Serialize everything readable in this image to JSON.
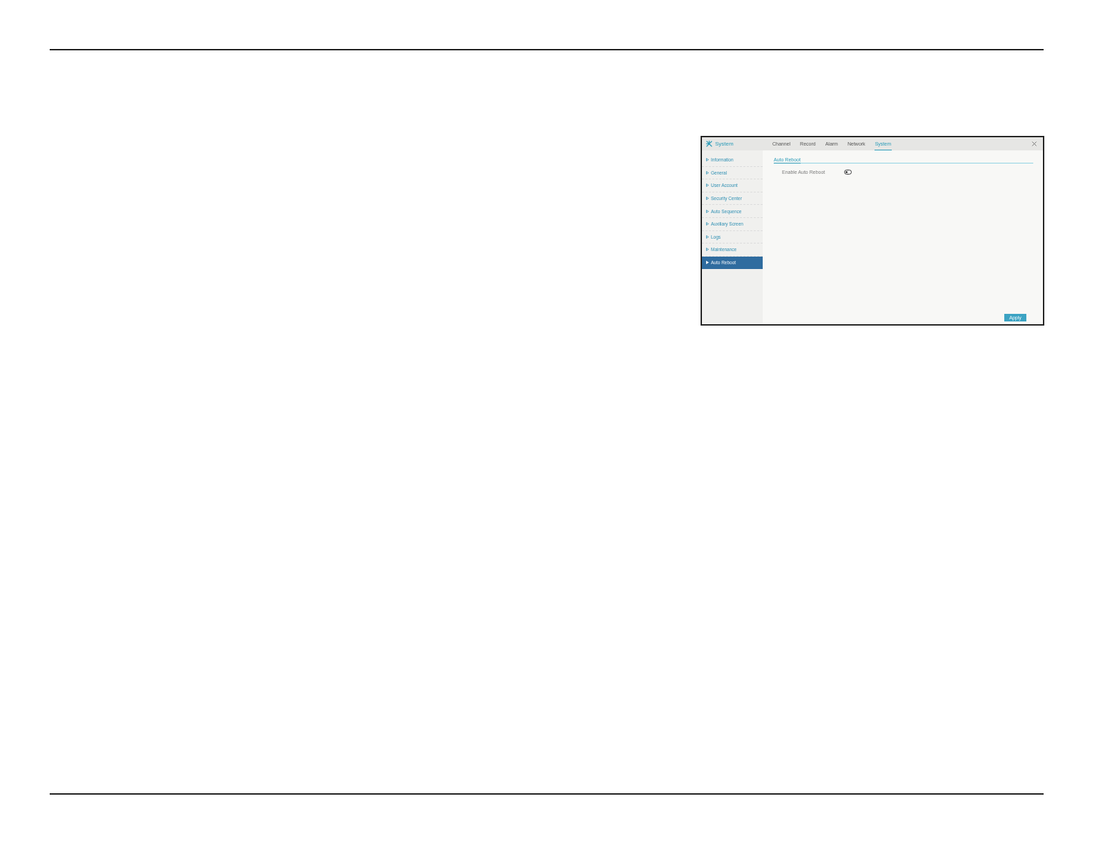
{
  "window": {
    "title": "System"
  },
  "tabs": [
    {
      "label": "Channel",
      "selected": false
    },
    {
      "label": "Record",
      "selected": false
    },
    {
      "label": "Alarm",
      "selected": false
    },
    {
      "label": "Network",
      "selected": false
    },
    {
      "label": "System",
      "selected": true
    }
  ],
  "sidebar": {
    "items": [
      {
        "label": "Information",
        "selected": false
      },
      {
        "label": "General",
        "selected": false
      },
      {
        "label": "User Account",
        "selected": false
      },
      {
        "label": "Security Center",
        "selected": false
      },
      {
        "label": "Auto Sequence",
        "selected": false
      },
      {
        "label": "Auxiliary Screen",
        "selected": false
      },
      {
        "label": "Logs",
        "selected": false
      },
      {
        "label": "Maintenance",
        "selected": false
      },
      {
        "label": "Auto Reboot",
        "selected": true
      }
    ]
  },
  "section": {
    "title": "Auto Reboot",
    "settings": [
      {
        "kind": "toggle",
        "label": "Enable Auto Reboot",
        "on": false
      }
    ]
  },
  "apply_button": {
    "label": "Apply"
  }
}
